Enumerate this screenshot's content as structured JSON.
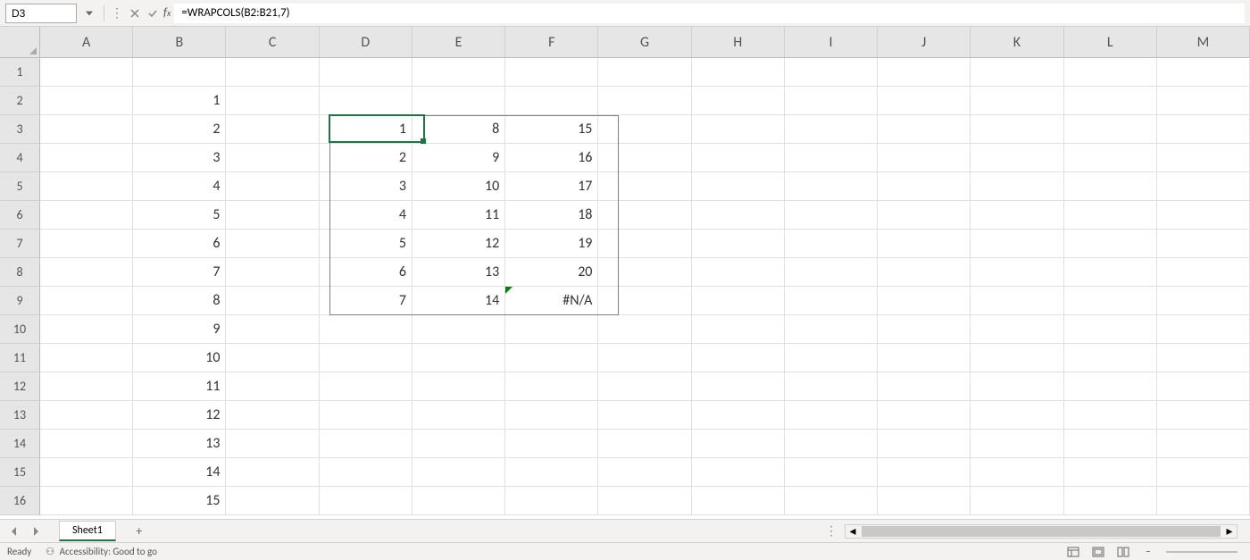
{
  "formula_bar": {
    "cell_reference": "D3",
    "formula": "=WRAPCOLS(B2:B21,7)"
  },
  "columns": [
    "A",
    "B",
    "C",
    "D",
    "E",
    "F",
    "G",
    "H",
    "I",
    "J",
    "K",
    "L",
    "M"
  ],
  "rows": [
    "1",
    "2",
    "3",
    "4",
    "5",
    "6",
    "7",
    "8",
    "9",
    "10",
    "11",
    "12",
    "13",
    "14",
    "15",
    "16"
  ],
  "cells": {
    "B2": "1",
    "B3": "2",
    "B4": "3",
    "B5": "4",
    "B6": "5",
    "B7": "6",
    "B8": "7",
    "B9": "8",
    "B10": "9",
    "B11": "10",
    "B12": "11",
    "B13": "12",
    "B14": "13",
    "B15": "14",
    "B16": "15",
    "D3": "1",
    "D4": "2",
    "D5": "3",
    "D6": "4",
    "D7": "5",
    "D8": "6",
    "D9": "7",
    "E3": "8",
    "E4": "9",
    "E5": "10",
    "E6": "11",
    "E7": "12",
    "E8": "13",
    "E9": "14",
    "F3": "15",
    "F4": "16",
    "F5": "17",
    "F6": "18",
    "F7": "19",
    "F8": "20",
    "F9": "#N/A"
  },
  "active_cell": "D3",
  "spill_range": {
    "start": "D3",
    "end": "F9"
  },
  "sheet": {
    "active_tab": "Sheet1"
  },
  "status": {
    "ready": "Ready",
    "accessibility": "Accessibility: Good to go"
  }
}
